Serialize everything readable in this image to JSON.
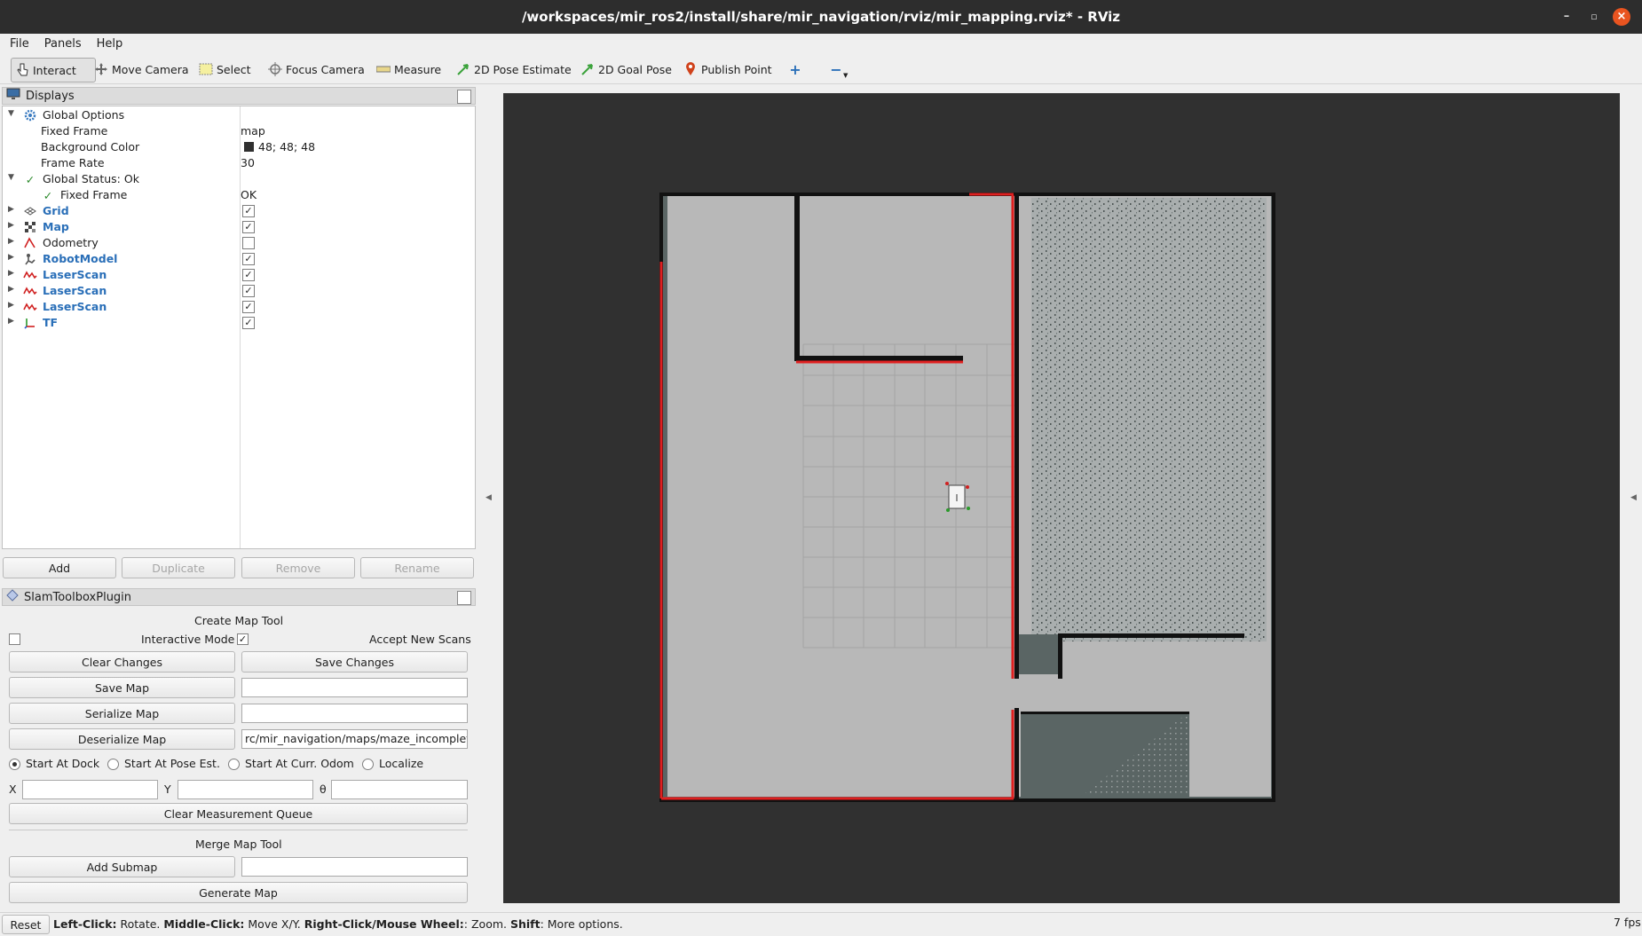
{
  "window": {
    "title": "/workspaces/mir_ros2/install/share/mir_navigation/rviz/mir_mapping.rviz* - RViz"
  },
  "menu": [
    "File",
    "Panels",
    "Help"
  ],
  "toolbar": {
    "interact": "Interact",
    "move_camera": "Move Camera",
    "select": "Select",
    "focus_camera": "Focus Camera",
    "measure": "Measure",
    "pose_estimate": "2D Pose Estimate",
    "goal_pose": "2D Goal Pose",
    "publish_point": "Publish Point"
  },
  "displays": {
    "title": "Displays",
    "global_options": "Global Options",
    "fixed_frame_label": "Fixed Frame",
    "fixed_frame_value": "map",
    "bg_color_label": "Background Color",
    "bg_color_value": "48; 48; 48",
    "bg_color_hex": "#303030",
    "frame_rate_label": "Frame Rate",
    "frame_rate_value": "30",
    "global_status": "Global Status: Ok",
    "status_fixed_frame": "Fixed Frame",
    "status_fixed_frame_value": "OK",
    "items": [
      {
        "name": "Grid",
        "checked": true
      },
      {
        "name": "Map",
        "checked": true
      },
      {
        "name": "Odometry",
        "checked": false
      },
      {
        "name": "RobotModel",
        "checked": true
      },
      {
        "name": "LaserScan",
        "checked": true
      },
      {
        "name": "LaserScan",
        "checked": true
      },
      {
        "name": "LaserScan",
        "checked": true
      },
      {
        "name": "TF",
        "checked": true
      }
    ],
    "buttons": {
      "add": "Add",
      "duplicate": "Duplicate",
      "remove": "Remove",
      "rename": "Rename"
    }
  },
  "slam": {
    "title": "SlamToolboxPlugin",
    "create_title": "Create Map Tool",
    "interactive_mode": "Interactive Mode",
    "accept_scans": "Accept New Scans",
    "clear_changes": "Clear Changes",
    "save_changes": "Save Changes",
    "save_map": "Save Map",
    "serialize_map": "Serialize Map",
    "deserialize_map": "Deserialize Map",
    "deserialize_path": "rc/mir_navigation/maps/maze_incomplete",
    "start_dock": "Start At Dock",
    "start_pose": "Start At Pose Est.",
    "start_odom": "Start At Curr. Odom",
    "localize": "Localize",
    "x_label": "X",
    "y_label": "Y",
    "theta_label": "θ",
    "clear_queue": "Clear Measurement Queue",
    "merge_title": "Merge Map Tool",
    "add_submap": "Add Submap",
    "generate_map": "Generate Map"
  },
  "status": {
    "reset": "Reset",
    "left_click": "Left-Click:",
    "rotate": " Rotate. ",
    "middle_click": "Middle-Click:",
    "move_xy": " Move X/Y. ",
    "right_click": "Right-Click/Mouse Wheel:",
    "zoom": ": Zoom. ",
    "shift": "Shift",
    "more": ": More options.",
    "fps": "7 fps"
  },
  "colors": {
    "laser": "#e02020",
    "free": "#b8b8b8",
    "unknown": "#5a6564"
  }
}
